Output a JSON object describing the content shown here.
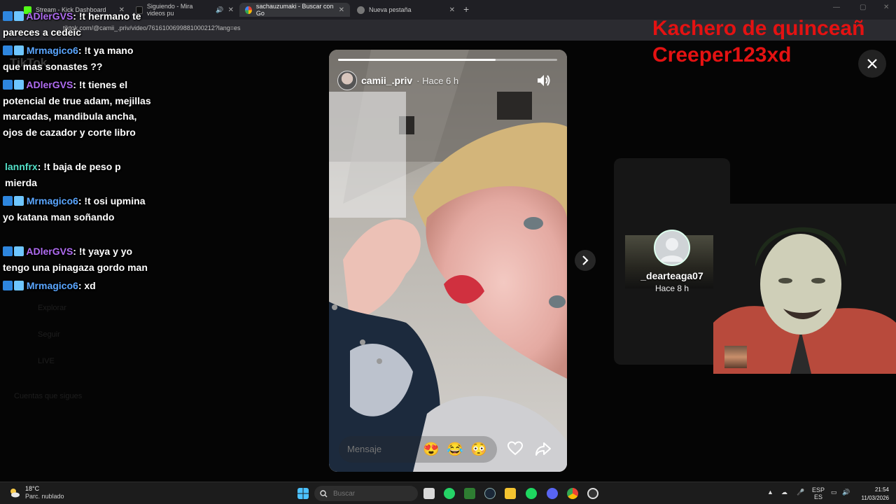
{
  "browser": {
    "tabs": [
      {
        "label": "Stream - Kick Dashboard"
      },
      {
        "label": "Siguiendo - Mira videos pu"
      },
      {
        "label": "sachauzumaki - Buscar con Go"
      },
      {
        "label": "Nueva pestaña"
      }
    ],
    "address": "tiktok.com/@camii_.priv/video/7616100699881000212?lang=es"
  },
  "page": {
    "logo": "TikTok",
    "ghost_items": [
      "Explorar",
      "Seguir",
      "LIVE"
    ],
    "ghost_section": "Cuentas que sigues"
  },
  "story": {
    "username": "camii_.priv",
    "time": "· Hace 6 h",
    "progress": 0.72,
    "message_placeholder": "Mensaje",
    "reactions": [
      "😍",
      "😂",
      "😳"
    ]
  },
  "next_story": {
    "username": "_dearteaga07",
    "time": "Hace 8 h"
  },
  "overlay": {
    "line1": "Kachero de quinceañ",
    "line2": "Creeper123xd"
  },
  "chat": [
    {
      "user": "ADlerGVS",
      "color": "#b06cf2",
      "text": ": !t hermano te pareces a cedeic",
      "badges": true
    },
    {
      "user": "Mrmagico6",
      "color": "#5aa6ff",
      "text": ": !t ya mano que mas sonastes ??",
      "badges": true
    },
    {
      "user": "ADlerGVS",
      "color": "#b06cf2",
      "text": ": !t tienes el potencial de true adam, mejillas marcadas, mandibula ancha, ojos de cazador y corte libro",
      "badges": true
    },
    {
      "user": "lannfrx",
      "color": "#53e0c8",
      "text": ": !t baja de peso p mierda",
      "badges": false
    },
    {
      "user": "Mrmagico6",
      "color": "#5aa6ff",
      "text": ": !t osi upmina yo katana man soñando",
      "badges": true
    },
    {
      "user": "ADlerGVS",
      "color": "#b06cf2",
      "text": ": !t yaya y yo tengo una pinagaza gordo man",
      "badges": true
    },
    {
      "user": "Mrmagico6",
      "color": "#5aa6ff",
      "text": ": xd",
      "badges": true
    }
  ],
  "taskbar": {
    "weather_temp": "18°C",
    "weather_desc": "Parc. nublado",
    "search_placeholder": "Buscar",
    "lang_top": "ESP",
    "lang_bottom": "ES",
    "time": "21:54",
    "date": "11/03/2026"
  }
}
